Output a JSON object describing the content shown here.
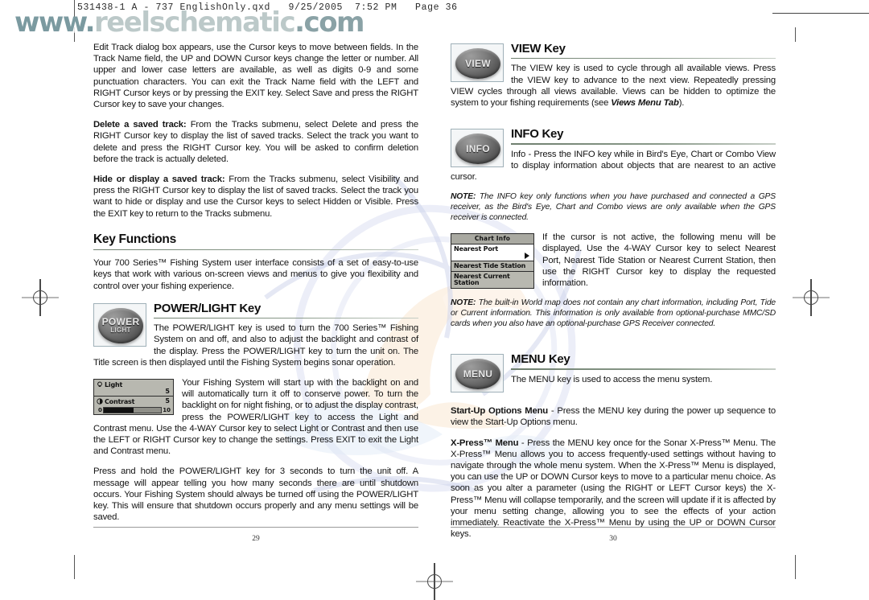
{
  "scan_header": {
    "text": "531438-1 A - 737 EnglishOnly.qxd   9/25/2005  7:52 PM   Page 36"
  },
  "site_logo": {
    "prefix": "www",
    "dot": ".",
    "mid": "reelschematic",
    "suffix": ".com"
  },
  "left_page": {
    "page_number": "29",
    "paragraphs": [
      {
        "id": "p-edit-track",
        "text": "Edit Track dialog box appears, use the Cursor keys to move between fields. In the Track Name field, the UP and DOWN Cursor keys change the letter or number. All upper and lower case letters are available, as well as digits 0-9 and some punctuation characters. You can exit the Track Name field with the LEFT and RIGHT Cursor keys or by pressing the EXIT key. Select Save and press the RIGHT Cursor key to save your changes."
      }
    ],
    "delete_track": {
      "lead": "Delete a saved track:",
      "text": " From the Tracks submenu, select Delete and press the RIGHT Cursor key to display the list of saved tracks. Select the track you want to delete and press the RIGHT Cursor key. You will be asked to confirm deletion before the track is actually deleted."
    },
    "hide_track": {
      "lead": "Hide or display a saved track:",
      "text": " From the Tracks submenu, select Visibility and press the RIGHT Cursor key to display the list of saved tracks. Select the track you want to hide or display and use the Cursor keys to select Hidden or Visible. Press the EXIT key to return to the Tracks submenu."
    },
    "key_functions": {
      "heading": "Key Functions",
      "intro": "Your 700 Series™ Fishing System user interface consists of a set of easy-to-use keys that work with various on-screen views and menus to give you flexibility and control over your fishing experience."
    },
    "power_light_key": {
      "heading": "POWER/LIGHT Key",
      "icon_label": "POWER",
      "icon_sublabel": "LIGHT",
      "body": "The POWER/LIGHT key is used to turn the 700 Series™ Fishing System on and off, and also to adjust the backlight and contrast of the display. Press the POWER/LIGHT key to turn the unit on.  The Title screen is then displayed until the Fishing System begins sonar operation."
    },
    "light_contrast_menu": {
      "light_label": "Light",
      "light_value": "5",
      "contrast_label": "Contrast",
      "contrast_value": "5",
      "bar_min": "0",
      "bar_max": "10"
    },
    "light_contrast_body": "Your Fishing System will start up with the backlight on and will automatically turn it off to conserve power.  To turn the backlight on for night fishing, or to adjust the display contrast, press the POWER/LIGHT key to access the Light and Contrast menu.  Use the 4-WAY Cursor key to select Light or Contrast and then use the LEFT or RIGHT Cursor key to change the settings.  Press EXIT to exit the Light and Contrast menu.",
    "shutdown_body": "Press and hold the POWER/LIGHT key for 3 seconds to turn the unit off. A message will appear telling you how many seconds there are until shutdown occurs. Your Fishing System should always be turned off using the POWER/LIGHT key.  This will ensure that shutdown occurs properly and any menu settings will be saved."
  },
  "right_page": {
    "page_number": "30",
    "view_key": {
      "heading": "VIEW Key",
      "icon_label": "VIEW",
      "body_part1": "The VIEW key is used to cycle through all available views. Press the VIEW key to advance to the next view. Repeatedly pressing VIEW cycles through all views available. Views can be hidden to optimize the system to your fishing requirements (see ",
      "body_italic": "Views Menu Tab",
      "body_part2": ")."
    },
    "info_key": {
      "heading": "INFO Key",
      "icon_label": "INFO",
      "body": "Info - Press the INFO key while in Bird's Eye, Chart or Combo View to display information about objects that are nearest to an active cursor.",
      "note_lead": "NOTE:",
      "note_text": " The INFO key only functions when you have purchased and connected a GPS receiver, as the Bird's Eye, Chart and Combo views are only available when the GPS receiver is connected."
    },
    "chart_info_menu": {
      "title": "Chart Info",
      "items": [
        {
          "label": "Nearest Port",
          "selected": true
        },
        {
          "label": "Nearest Tide Station",
          "selected": false
        },
        {
          "label": "Nearest Current Station",
          "selected": false
        }
      ]
    },
    "chart_info_body": "If the cursor is not active, the following menu will be displayed. Use the 4-WAY Cursor key to select Nearest Port, Nearest Tide Station or Nearest Current Station,  then use the RIGHT Cursor key to display the requested information.",
    "chart_info_note": {
      "lead": "NOTE:",
      "text": " The built-in World map does not contain any chart information, including Port, Tide or Current information. This information is only available from optional-purchase MMC/SD cards when you also have an optional-purchase GPS Receiver connected."
    },
    "menu_key": {
      "heading": "MENU Key",
      "icon_label": "MENU",
      "body": "The MENU key is used to access the menu system."
    },
    "startup_options": {
      "lead": "Start-Up Options Menu",
      "text": " - Press the MENU key during the power up sequence to view the Start-Up Options menu."
    },
    "xpress_menu": {
      "lead": "X-Press™ Menu",
      "text": " -  Press the MENU key once for the Sonar X-Press™ Menu. The X-Press™ Menu allows you to access frequently-used settings without having to navigate through the whole menu system. When the X-Press™ Menu is displayed, you can use the UP or DOWN Cursor keys to move to a particular menu choice. As soon as you alter a parameter (using the RIGHT or LEFT Cursor keys) the X-Press™ Menu will collapse temporarily, and the screen will update if it is affected by your menu setting change, allowing you to see the effects of your action immediately. Reactivate the X-Press™ Menu by using the UP or DOWN Cursor keys."
    }
  },
  "colors": {
    "rule_accent": "#6f7f6f",
    "menu_gray": "#b8b8b0",
    "button_dark": "#5b5b5b"
  }
}
